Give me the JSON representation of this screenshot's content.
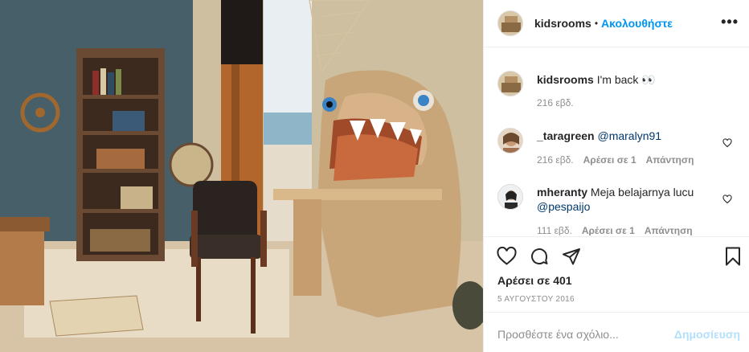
{
  "header": {
    "username": "kidsrooms",
    "separator": "•",
    "follow_label": "Ακολουθήστε",
    "more_label": "•••"
  },
  "caption": {
    "username": "kidsrooms",
    "text": "I'm back 👀",
    "time": "216 εβδ."
  },
  "comments": [
    {
      "username": "_taragreen",
      "mention": "@maralyn91",
      "text": "",
      "time": "216 εβδ.",
      "likes": "Αρέσει σε 1",
      "reply": "Απάντηση"
    },
    {
      "username": "mheranty",
      "text": "Meja belajarnya lucu",
      "mention": "@pespaijo",
      "time": "111 εβδ.",
      "likes": "Αρέσει σε 1",
      "reply": "Απάντηση"
    }
  ],
  "actions": {
    "likes_text": "Αρέσει σε 401",
    "date_text": "5 ΑΥΓΟΥΣΤΟΥ 2016"
  },
  "add_comment": {
    "placeholder": "Προσθέστε ένα σχόλιο...",
    "post_label": "Δημοσίευση"
  },
  "icons": {
    "like": "heart-icon",
    "comment": "comment-icon",
    "share": "paper-plane-icon",
    "save": "bookmark-icon",
    "comment_like": "heart-small-icon"
  },
  "colors": {
    "link": "#0095f6",
    "post_disabled": "#b2dffc",
    "secondary_text": "#8e8e8e"
  }
}
